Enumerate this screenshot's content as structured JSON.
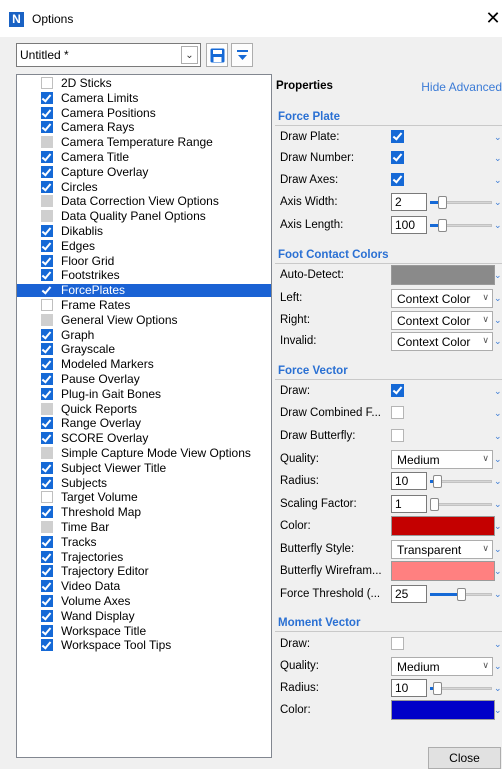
{
  "window": {
    "title": "Options",
    "icon": "app-n-icon",
    "close_glyph": "✕"
  },
  "toolbar": {
    "preset_value": "Untitled *",
    "dropdown_glyph": "⌄"
  },
  "options_list": [
    {
      "label": "2D Sticks",
      "state": "off"
    },
    {
      "label": "Camera Limits",
      "state": "on"
    },
    {
      "label": "Camera Positions",
      "state": "on"
    },
    {
      "label": "Camera Rays",
      "state": "on"
    },
    {
      "label": "Camera Temperature Range",
      "state": "ind"
    },
    {
      "label": "Camera Title",
      "state": "on"
    },
    {
      "label": "Capture Overlay",
      "state": "on"
    },
    {
      "label": "Circles",
      "state": "on"
    },
    {
      "label": "Data Correction View Options",
      "state": "ind"
    },
    {
      "label": "Data Quality Panel Options",
      "state": "ind"
    },
    {
      "label": "Dikablis",
      "state": "on"
    },
    {
      "label": "Edges",
      "state": "on"
    },
    {
      "label": "Floor Grid",
      "state": "on"
    },
    {
      "label": "Footstrikes",
      "state": "on"
    },
    {
      "label": "ForcePlates",
      "state": "on",
      "selected": true
    },
    {
      "label": "Frame Rates",
      "state": "off"
    },
    {
      "label": "General View Options",
      "state": "ind"
    },
    {
      "label": "Graph",
      "state": "on"
    },
    {
      "label": "Grayscale",
      "state": "on"
    },
    {
      "label": "Modeled Markers",
      "state": "on"
    },
    {
      "label": "Pause Overlay",
      "state": "on"
    },
    {
      "label": "Plug-in Gait Bones",
      "state": "on"
    },
    {
      "label": "Quick Reports",
      "state": "ind"
    },
    {
      "label": "Range Overlay",
      "state": "on"
    },
    {
      "label": "SCORE Overlay",
      "state": "on"
    },
    {
      "label": "Simple Capture Mode View Options",
      "state": "ind"
    },
    {
      "label": "Subject Viewer Title",
      "state": "on"
    },
    {
      "label": "Subjects",
      "state": "on"
    },
    {
      "label": "Target Volume",
      "state": "off"
    },
    {
      "label": "Threshold Map",
      "state": "on"
    },
    {
      "label": "Time Bar",
      "state": "ind"
    },
    {
      "label": "Tracks",
      "state": "on"
    },
    {
      "label": "Trajectories",
      "state": "on"
    },
    {
      "label": "Trajectory Editor",
      "state": "on"
    },
    {
      "label": "Video Data",
      "state": "on"
    },
    {
      "label": "Volume Axes",
      "state": "on"
    },
    {
      "label": "Wand Display",
      "state": "on"
    },
    {
      "label": "Workspace Title",
      "state": "on"
    },
    {
      "label": "Workspace Tool Tips",
      "state": "on"
    }
  ],
  "properties": {
    "title": "Properties",
    "hide_advanced": "Hide Advanced",
    "chevron_glyph": "⌄",
    "select_arrow": "∨",
    "force_plate": {
      "heading": "Force Plate",
      "draw_plate": {
        "label": "Draw Plate:",
        "checked": true
      },
      "draw_number": {
        "label": "Draw Number:",
        "checked": true
      },
      "draw_axes": {
        "label": "Draw Axes:",
        "checked": true
      },
      "axis_width": {
        "label": "Axis Width:",
        "value": "2",
        "level": 0.15
      },
      "axis_length": {
        "label": "Axis Length:",
        "value": "100",
        "level": 0.15
      }
    },
    "foot_contact": {
      "heading": "Foot Contact Colors",
      "auto_detect": {
        "label": "Auto-Detect:",
        "color": "#8a8a8a"
      },
      "left": {
        "label": "Left:",
        "value": "Context Color"
      },
      "right": {
        "label": "Right:",
        "value": "Context Color"
      },
      "invalid": {
        "label": "Invalid:",
        "value": "Context Color"
      }
    },
    "force_vector": {
      "heading": "Force Vector",
      "draw": {
        "label": "Draw:",
        "checked": true
      },
      "draw_combined": {
        "label": "Draw Combined F...",
        "checked": false
      },
      "draw_butterfly": {
        "label": "Draw Butterfly:",
        "checked": false
      },
      "quality": {
        "label": "Quality:",
        "value": "Medium"
      },
      "radius": {
        "label": "Radius:",
        "value": "10",
        "level": 0.05
      },
      "scaling": {
        "label": "Scaling Factor:",
        "value": "1",
        "level": 0.0
      },
      "color": {
        "label": "Color:",
        "color": "#c40000"
      },
      "butterfly_style": {
        "label": "Butterfly Style:",
        "value": "Transparent"
      },
      "butterfly_wireframe": {
        "label": "Butterfly Wirefram...",
        "color": "#ff8080"
      },
      "force_threshold": {
        "label": "Force Threshold (...",
        "value": "25",
        "level": 0.5
      }
    },
    "moment_vector": {
      "heading": "Moment Vector",
      "draw": {
        "label": "Draw:",
        "checked": false
      },
      "quality": {
        "label": "Quality:",
        "value": "Medium"
      },
      "radius": {
        "label": "Radius:",
        "value": "10",
        "level": 0.05
      },
      "color": {
        "label": "Color:",
        "color": "#0000c8"
      }
    }
  },
  "footer": {
    "close_label": "Close"
  },
  "colors": {
    "accent": "#1a62d4",
    "link": "#2a70d3"
  }
}
